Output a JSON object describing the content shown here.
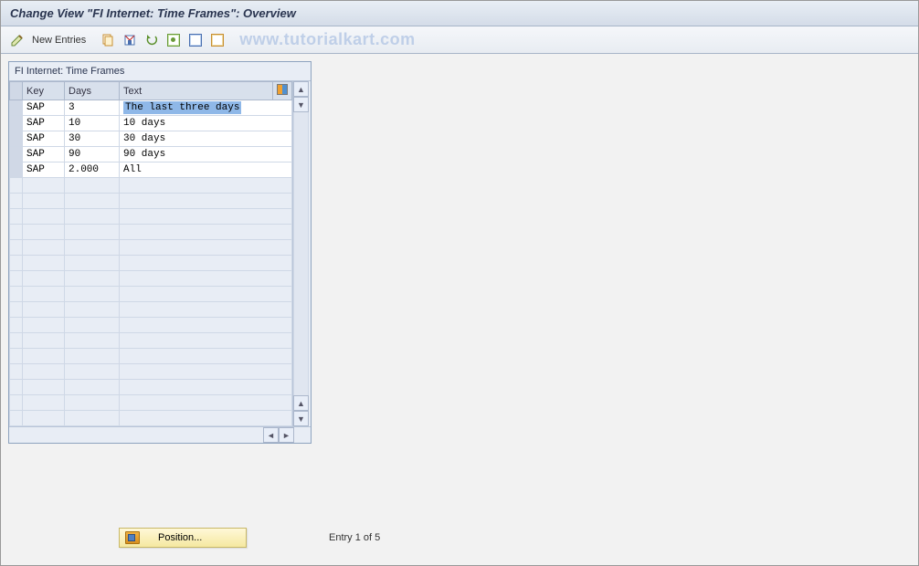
{
  "header": {
    "title": "Change View \"FI Internet: Time Frames\": Overview"
  },
  "toolbar": {
    "new_entries_label": "New Entries"
  },
  "watermark": "www.tutorialkart.com",
  "grid": {
    "title": "FI Internet: Time Frames",
    "columns": {
      "key": "Key",
      "days": "Days",
      "text": "Text"
    },
    "rows": [
      {
        "key": "SAP",
        "days": "3",
        "text": "The last three days",
        "selected": true
      },
      {
        "key": "SAP",
        "days": "10",
        "text": "10 days",
        "selected": false
      },
      {
        "key": "SAP",
        "days": "30",
        "text": "30 days",
        "selected": false
      },
      {
        "key": "SAP",
        "days": "90",
        "text": "90 days",
        "selected": false
      },
      {
        "key": "SAP",
        "days": "2.000",
        "text": "All",
        "selected": false
      }
    ],
    "empty_row_count": 16
  },
  "footer": {
    "position_button_label": "Position...",
    "entry_status": "Entry 1 of 5"
  }
}
